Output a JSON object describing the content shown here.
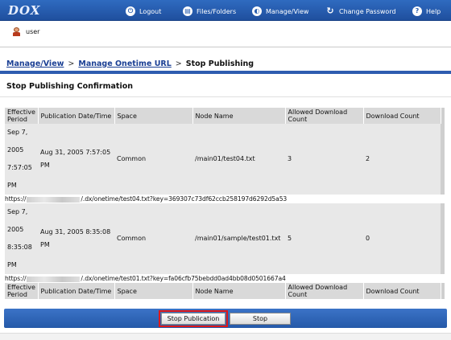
{
  "header": {
    "logo": "DOX",
    "nav": [
      {
        "label": "Logout",
        "icon": "logout-icon",
        "glyph": "⏻"
      },
      {
        "label": "Files/Folders",
        "icon": "folder-icon",
        "glyph": "▤"
      },
      {
        "label": "Manage/View",
        "icon": "manage-icon",
        "glyph": "◐"
      },
      {
        "label": "Change Password",
        "icon": "refresh-icon",
        "glyph": "↻"
      },
      {
        "label": "Help",
        "icon": "help-icon",
        "glyph": "?"
      }
    ]
  },
  "user": {
    "name": "user"
  },
  "breadcrumb": {
    "item1": "Manage/View",
    "item2": "Manage Onetime URL",
    "current": "Stop Publishing",
    "separator": ">"
  },
  "panel": {
    "title": "Stop Publishing Confirmation"
  },
  "table": {
    "headers": [
      "Effective Period",
      "Publication Date/Time",
      "Space",
      "Node Name",
      "Allowed Download Count",
      "Download Count"
    ],
    "rows": [
      {
        "effective_lines": [
          "Sep 7,",
          "2005",
          "7:57:05",
          "PM"
        ],
        "published_lines": [
          "Aug 31, 2005 7:57:05",
          "PM"
        ],
        "space": "Common",
        "node": "/main01/test04.txt",
        "allowed": "3",
        "count": "2",
        "url_prefix": "https://",
        "url_suffix": "/.dx/onetime/test04.txt?key=369307c73df62ccb258197d6292d5a53"
      },
      {
        "effective_lines": [
          "Sep 7,",
          "2005",
          "8:35:08",
          "PM"
        ],
        "published_lines": [
          "Aug 31, 2005 8:35:08",
          "PM"
        ],
        "space": "Common",
        "node": "/main01/sample/test01.txt",
        "allowed": "5",
        "count": "0",
        "url_prefix": "https://",
        "url_suffix": "/.dx/onetime/test01.txt?key=fa06cfb75bebdd0ad4bb08d0501667a4"
      }
    ]
  },
  "buttons": {
    "stop_publication": "Stop Publication",
    "stop": "Stop"
  },
  "colors": {
    "header": "#2a5fb0",
    "accent_rule": "#2e5cb0",
    "highlight": "#e01818"
  }
}
